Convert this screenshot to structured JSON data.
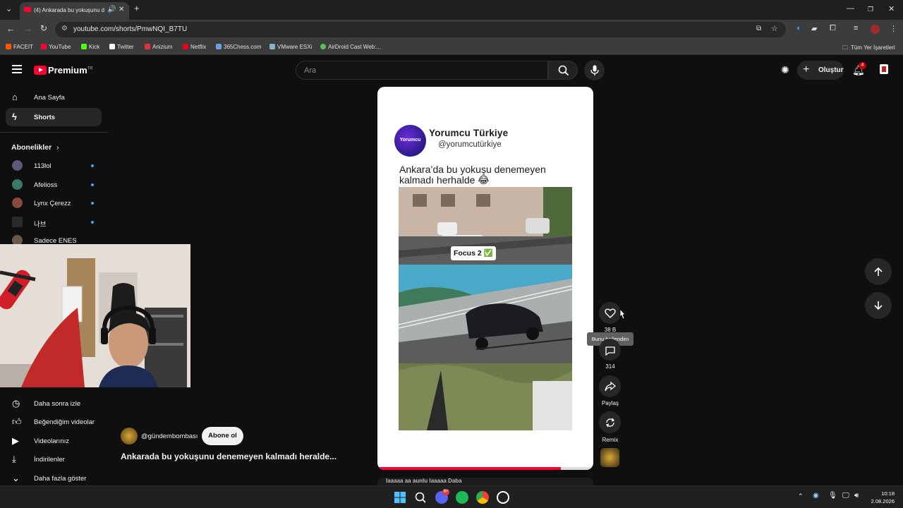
{
  "browser": {
    "tab_title": "(4) Ankarada bu yokuşunu d",
    "url": "youtube.com/shorts/PmwNQI_B7TU",
    "bookmarks": [
      {
        "label": "FACEIT",
        "color": "#ff5500"
      },
      {
        "label": "YouTube",
        "color": "#ff0033"
      },
      {
        "label": "Kick",
        "color": "#53fc18"
      },
      {
        "label": "Twitter",
        "color": "#ffffff"
      },
      {
        "label": "Anizium",
        "color": "#e0343c"
      },
      {
        "label": "Netflix",
        "color": "#e50914"
      },
      {
        "label": "365Chess.com",
        "color": "#6aa0e0"
      },
      {
        "label": "VMware ESXi",
        "color": "#7fb8c8"
      },
      {
        "label": "AirDroid Cast Web:...",
        "color": "#58c05a"
      }
    ],
    "all_bookmarks_label": "Tüm Yer İşaretleri"
  },
  "header": {
    "logo_text": "Premium",
    "logo_region": "TR",
    "search_placeholder": "Ara",
    "create_label": "Oluştur",
    "notification_count": "4"
  },
  "sidebar": {
    "main": [
      {
        "label": "Ana Sayfa",
        "icon": "home-icon"
      },
      {
        "label": "Shorts",
        "icon": "shorts-icon"
      }
    ],
    "subscriptions_title": "Abonelikler",
    "subscriptions": [
      {
        "label": "113lol",
        "color": "#5a5a7a"
      },
      {
        "label": "Afelioss",
        "color": "#3a7a6a"
      },
      {
        "label": "Lynx Çerezz",
        "color": "#8a4a3a"
      },
      {
        "label": "나브",
        "color": "#2a2a2a"
      },
      {
        "label": "Sadece ENES",
        "color": "#6a5a4a"
      }
    ],
    "you_items": [
      {
        "label": "Daha sonra izle",
        "icon": "clock-icon"
      },
      {
        "label": "Beğendiğim videolar",
        "icon": "thumbs-up-icon"
      },
      {
        "label": "Videolarınız",
        "icon": "video-icon"
      },
      {
        "label": "İndirilenler",
        "icon": "download-icon"
      },
      {
        "label": "Daha fazla göster",
        "icon": "chevron-down-icon"
      }
    ]
  },
  "short": {
    "card_channel_name": "Yorumcu Türkiye",
    "card_channel_handle": "@yorumcutürkiye",
    "card_logo_text": "Yorumcu",
    "caption": "Ankara’da bu yokuşu denemeyen kalmadı herhalde 😂",
    "clip_label": "Focus 2 ✅",
    "progress": 0.85,
    "owner_handle": "@gündembombası",
    "subscribe_label": "Abone ol",
    "title": "Ankarada bu yokuşunu denemeyen kalmadı heralde...",
    "next_caption_peek": "Iaaaaa aa aunlu laaaaa Daba"
  },
  "actions": {
    "like_count": "38 B",
    "like_tooltip": "Bunu beğendim",
    "comment_count": "314",
    "share_label": "Paylaş",
    "remix_label": "Remix"
  },
  "taskbar": {
    "time": "10:18",
    "date": "2.08.2026",
    "discord_badge": "9+"
  }
}
